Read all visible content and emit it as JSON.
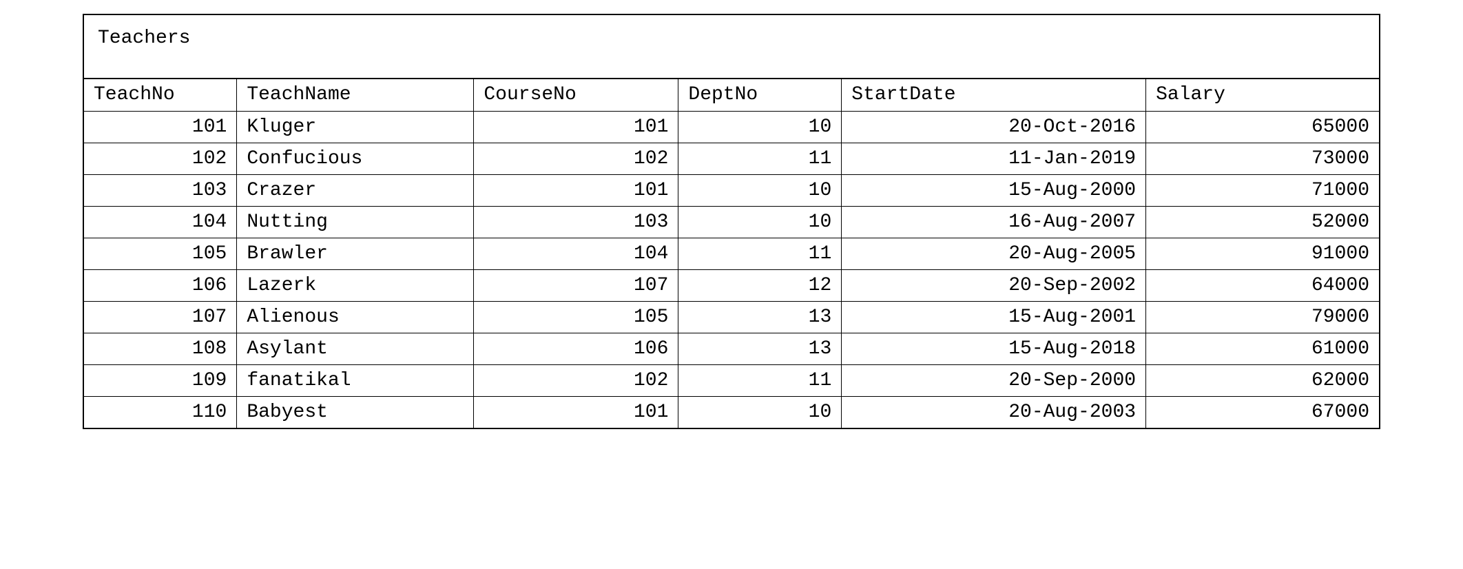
{
  "table": {
    "title": "Teachers",
    "columns": [
      {
        "key": "teachNo",
        "label": "TeachNo",
        "align": "num"
      },
      {
        "key": "teachName",
        "label": "TeachName",
        "align": "txt"
      },
      {
        "key": "courseNo",
        "label": "CourseNo",
        "align": "num"
      },
      {
        "key": "deptNo",
        "label": "DeptNo",
        "align": "num"
      },
      {
        "key": "startDate",
        "label": "StartDate",
        "align": "num"
      },
      {
        "key": "salary",
        "label": "Salary",
        "align": "num"
      }
    ],
    "rows": [
      {
        "teachNo": "101",
        "teachName": "Kluger",
        "courseNo": "101",
        "deptNo": "10",
        "startDate": "20-Oct-2016",
        "salary": "65000"
      },
      {
        "teachNo": "102",
        "teachName": "Confucious",
        "courseNo": "102",
        "deptNo": "11",
        "startDate": "11-Jan-2019",
        "salary": "73000"
      },
      {
        "teachNo": "103",
        "teachName": "Crazer",
        "courseNo": "101",
        "deptNo": "10",
        "startDate": "15-Aug-2000",
        "salary": "71000"
      },
      {
        "teachNo": "104",
        "teachName": "Nutting",
        "courseNo": "103",
        "deptNo": "10",
        "startDate": "16-Aug-2007",
        "salary": "52000"
      },
      {
        "teachNo": "105",
        "teachName": "Brawler",
        "courseNo": "104",
        "deptNo": "11",
        "startDate": "20-Aug-2005",
        "salary": "91000"
      },
      {
        "teachNo": "106",
        "teachName": "Lazerk",
        "courseNo": "107",
        "deptNo": "12",
        "startDate": "20-Sep-2002",
        "salary": "64000"
      },
      {
        "teachNo": "107",
        "teachName": "Alienous",
        "courseNo": "105",
        "deptNo": "13",
        "startDate": "15-Aug-2001",
        "salary": "79000"
      },
      {
        "teachNo": "108",
        "teachName": "Asylant",
        "courseNo": "106",
        "deptNo": "13",
        "startDate": "15-Aug-2018",
        "salary": "61000"
      },
      {
        "teachNo": "109",
        "teachName": "fanatikal",
        "courseNo": "102",
        "deptNo": "11",
        "startDate": "20-Sep-2000",
        "salary": "62000"
      },
      {
        "teachNo": "110",
        "teachName": "Babyest",
        "courseNo": "101",
        "deptNo": "10",
        "startDate": "20-Aug-2003",
        "salary": "67000"
      }
    ]
  }
}
